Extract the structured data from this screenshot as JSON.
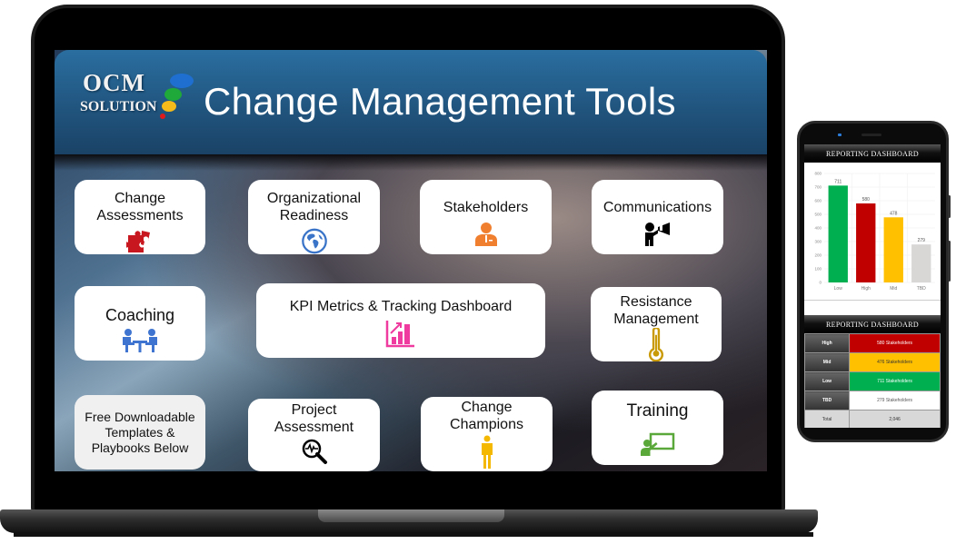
{
  "header": {
    "logo_line1": "OCM",
    "logo_line2": "SOLUTION",
    "title": "Change Management Tools"
  },
  "cards": [
    {
      "id": "change-assessments",
      "label": "Change\nAssessments",
      "icon": "puzzle-icon",
      "icon_color": "#c8171e"
    },
    {
      "id": "organizational-readiness",
      "label": "Organizational\nReadiness",
      "icon": "globe-icon",
      "icon_color": "#3a74c8"
    },
    {
      "id": "stakeholders",
      "label": "Stakeholders",
      "icon": "businessperson-icon",
      "icon_color": "#f08030"
    },
    {
      "id": "communications",
      "label": "Communications",
      "icon": "megaphone-person-icon",
      "icon_color": "#000000"
    },
    {
      "id": "coaching",
      "label": "Coaching",
      "icon": "meeting-table-icon",
      "icon_color": "#3f74d0"
    },
    {
      "id": "kpi-metrics",
      "label": "KPI Metrics & Tracking Dashboard",
      "icon": "bar-chart-growth-icon",
      "icon_color": "#ef3aa0"
    },
    {
      "id": "resistance-management",
      "label": "Resistance\nManagement",
      "icon": "thermometer-icon",
      "icon_color": "#c99a06"
    },
    {
      "id": "free-templates",
      "label": "Free Downloadable\nTemplates &\nPlaybooks Below",
      "icon": null,
      "icon_color": null
    },
    {
      "id": "project-assessment",
      "label": "Project\nAssessment",
      "icon": "magnifier-pulse-icon",
      "icon_color": "#000000"
    },
    {
      "id": "change-champions",
      "label": "Change\nChampions",
      "icon": "person-standing-icon",
      "icon_color": "#f5b800"
    },
    {
      "id": "training",
      "label": "Training",
      "icon": "presentation-board-icon",
      "icon_color": "#5aa83a"
    }
  ],
  "phone": {
    "chart_title": "REPORTING DASHBOARD",
    "table_title": "REPORTING DASHBOARD",
    "table_rows": [
      {
        "key": "High",
        "value": "580 Stakeholders",
        "bg": "#c00000",
        "fg": "#ffffff"
      },
      {
        "key": "Mid",
        "value": "476 Stakeholders",
        "bg": "#ffc000",
        "fg": "#333333"
      },
      {
        "key": "Low",
        "value": "711 Stakeholders",
        "bg": "#00b050",
        "fg": "#ffffff"
      },
      {
        "key": "TBD",
        "value": "279 Stakeholders",
        "bg": "#ffffff",
        "fg": "#555555"
      }
    ],
    "total_label": "Total",
    "total_value": "2,046"
  },
  "chart_data": {
    "type": "bar",
    "title": "REPORTING DASHBOARD",
    "categories": [
      "Low",
      "High",
      "Mid",
      "TBD"
    ],
    "values": [
      711,
      580,
      478,
      279
    ],
    "colors": [
      "#00b050",
      "#c00000",
      "#ffc000",
      "#d9d6d6"
    ],
    "data_labels": [
      "711",
      "580",
      "478",
      "279"
    ],
    "xlabel": "",
    "ylabel": "",
    "ylim": [
      0,
      800
    ],
    "yticks": [
      0,
      100,
      200,
      300,
      400,
      500,
      600,
      700,
      800
    ],
    "grid": true,
    "legend": "none"
  }
}
